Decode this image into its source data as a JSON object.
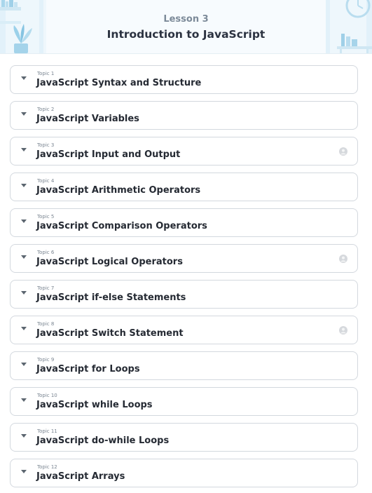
{
  "header": {
    "lesson_label": "Lesson 3",
    "title": "Introduction to JavaScript"
  },
  "topics": [
    {
      "number": "Topic 1",
      "name": "JavaScript Syntax and Structure",
      "has_user_icon": false
    },
    {
      "number": "Topic 2",
      "name": "JavaScript Variables",
      "has_user_icon": false
    },
    {
      "number": "Topic 3",
      "name": "JavaScript Input and Output",
      "has_user_icon": true
    },
    {
      "number": "Topic 4",
      "name": "JavaScript Arithmetic Operators",
      "has_user_icon": false
    },
    {
      "number": "Topic 5",
      "name": "JavaScript Comparison Operators",
      "has_user_icon": false
    },
    {
      "number": "Topic 6",
      "name": "JavaScript Logical Operators",
      "has_user_icon": true
    },
    {
      "number": "Topic 7",
      "name": "JavaScript if-else Statements",
      "has_user_icon": false
    },
    {
      "number": "Topic 8",
      "name": "JavaScript Switch Statement",
      "has_user_icon": true
    },
    {
      "number": "Topic 9",
      "name": "JavaScript for Loops",
      "has_user_icon": false
    },
    {
      "number": "Topic 10",
      "name": "JavaScript while Loops",
      "has_user_icon": false
    },
    {
      "number": "Topic 11",
      "name": "JavaScript do-while Loops",
      "has_user_icon": false
    },
    {
      "number": "Topic 12",
      "name": "JavaScript Arrays",
      "has_user_icon": false
    }
  ],
  "icons": {
    "caret": "chevron-down-icon",
    "user": "user-avatar-icon"
  },
  "colors": {
    "header_bg": "#eef7fc",
    "accent": "#8ec9e6",
    "title": "#2b3240",
    "border": "#d3d8de"
  }
}
